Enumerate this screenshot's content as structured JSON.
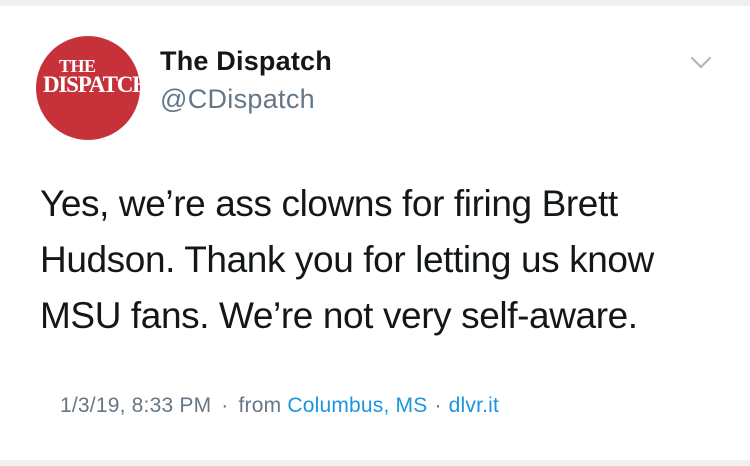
{
  "tweet": {
    "avatar": {
      "logo_line1": "THE",
      "logo_line2": "DISPATCH",
      "brand_color": "#c7313a"
    },
    "display_name": "The Dispatch",
    "handle": "@CDispatch",
    "menu_icon": "chevron-down-icon",
    "text_lines": [
      "Yes, we’re ass clowns for firing Brett",
      "Hudson. Thank you for letting us know",
      "MSU fans. We’re not very self-aware."
    ],
    "meta": {
      "timestamp": "1/3/19, 8:33 PM",
      "separator": "·",
      "from_label": "from",
      "location": "Columbus, MS",
      "source": "dlvr.it"
    },
    "colors": {
      "name": "#14171a",
      "secondary": "#657786",
      "link": "#1b95e0"
    }
  }
}
